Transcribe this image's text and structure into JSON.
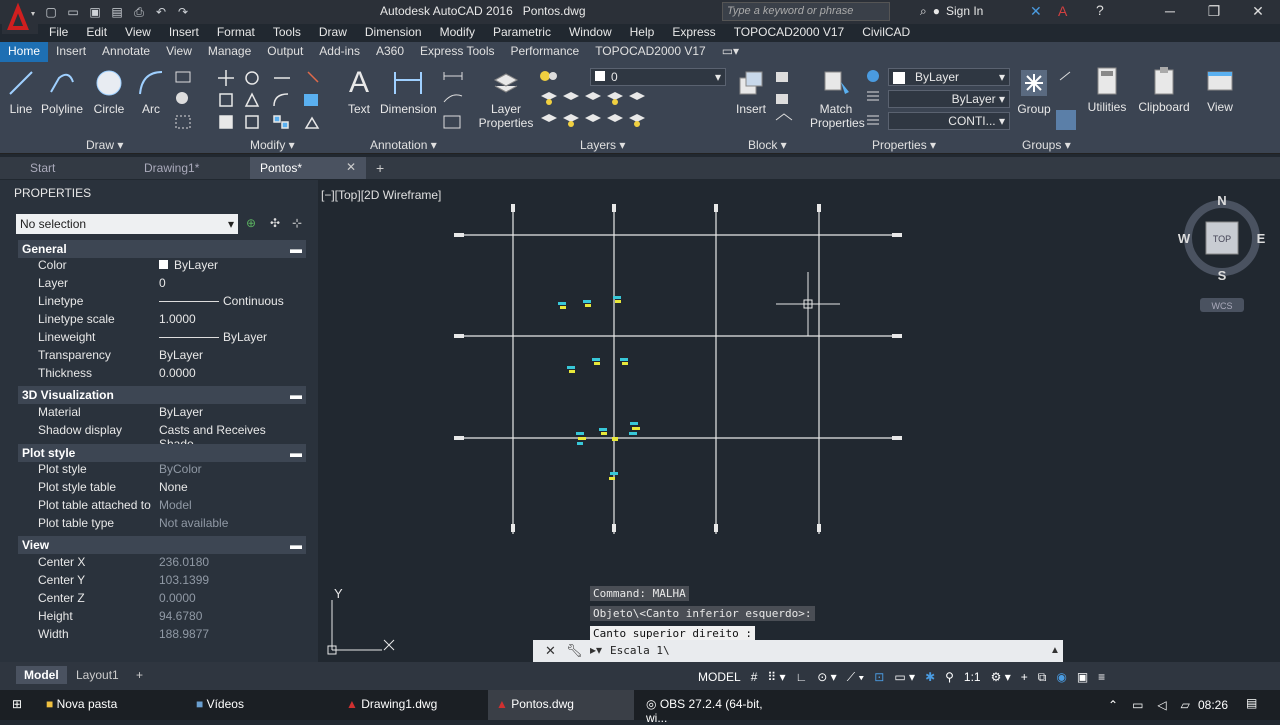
{
  "titlebar": {
    "app_title": "Autodesk AutoCAD 2016",
    "file_title": "Pontos.dwg",
    "search_placeholder": "Type a keyword or phrase",
    "sign_in": "Sign In"
  },
  "menu": [
    "File",
    "Edit",
    "View",
    "Insert",
    "Format",
    "Tools",
    "Draw",
    "Dimension",
    "Modify",
    "Parametric",
    "Window",
    "Help",
    "Express",
    "TOPOCAD2000 V17",
    "CivilCAD"
  ],
  "ribbon_tabs": [
    "Home",
    "Insert",
    "Annotate",
    "View",
    "Manage",
    "Output",
    "Add-ins",
    "A360",
    "Express Tools",
    "Performance",
    "TOPOCAD2000 V17"
  ],
  "ribbon": {
    "draw_buttons": [
      "Line",
      "Polyline",
      "Circle",
      "Arc"
    ],
    "text": "Text",
    "dimension": "Dimension",
    "layer_props": [
      "Layer",
      "Properties"
    ],
    "insert": "Insert",
    "match_props": [
      "Match",
      "Properties"
    ],
    "group": "Group",
    "utilities": "Utilities",
    "clipboard": "Clipboard",
    "view": "View",
    "layer_value": "0",
    "color_value": "ByLayer",
    "linetype_value": "ByLayer",
    "lineweight_value": "CONTI...",
    "panels": [
      "Draw",
      "Modify",
      "Annotation",
      "Layers",
      "Block",
      "Properties",
      "Groups"
    ]
  },
  "doc_tabs": [
    "Start",
    "Drawing1*",
    "Pontos*"
  ],
  "properties": {
    "title": "PROPERTIES",
    "selection": "No selection",
    "sections": {
      "general": "General",
      "viz": "3D Visualization",
      "plot": "Plot style",
      "view": "View"
    },
    "general": [
      [
        "Color",
        "ByLayer"
      ],
      [
        "Layer",
        "0"
      ],
      [
        "Linetype",
        "Continuous"
      ],
      [
        "Linetype scale",
        "1.0000"
      ],
      [
        "Lineweight",
        "ByLayer"
      ],
      [
        "Transparency",
        "ByLayer"
      ],
      [
        "Thickness",
        "0.0000"
      ]
    ],
    "viz": [
      [
        "Material",
        "ByLayer"
      ],
      [
        "Shadow display",
        "Casts and Receives Shado..."
      ]
    ],
    "plot": [
      [
        "Plot style",
        "ByColor"
      ],
      [
        "Plot style table",
        "None"
      ],
      [
        "Plot table attached to",
        "Model"
      ],
      [
        "Plot table type",
        "Not available"
      ]
    ],
    "view": [
      [
        "Center X",
        "236.0180"
      ],
      [
        "Center Y",
        "103.1399"
      ],
      [
        "Center Z",
        "0.0000"
      ],
      [
        "Height",
        "94.6780"
      ],
      [
        "Width",
        "188.9877"
      ]
    ]
  },
  "viewport": {
    "label": "[−][Top][2D Wireframe]",
    "compass": {
      "n": "N",
      "s": "S",
      "e": "E",
      "w": "W",
      "top": "TOP",
      "wcs": "WCS"
    },
    "ucs_y": "Y"
  },
  "command": {
    "history": [
      "Command: MALHA",
      "Objeto\\<Canto inferior esquerdo>:",
      "Canto superior direito :"
    ],
    "input": "Escala 1\\"
  },
  "layout_tabs": [
    "Model",
    "Layout1"
  ],
  "status": {
    "model": "MODEL",
    "scale": "1:1"
  },
  "taskbar": {
    "items": [
      "Nova pasta",
      "Vídeos",
      "Drawing1.dwg",
      "Pontos.dwg",
      "OBS 27.2.4 (64-bit, wi..."
    ],
    "clock": "08:26"
  },
  "colors": {
    "accent": "#1e6fb3",
    "canvas": "#212830",
    "points_yellow": "#e8e83a",
    "points_cyan": "#38c8d8"
  }
}
